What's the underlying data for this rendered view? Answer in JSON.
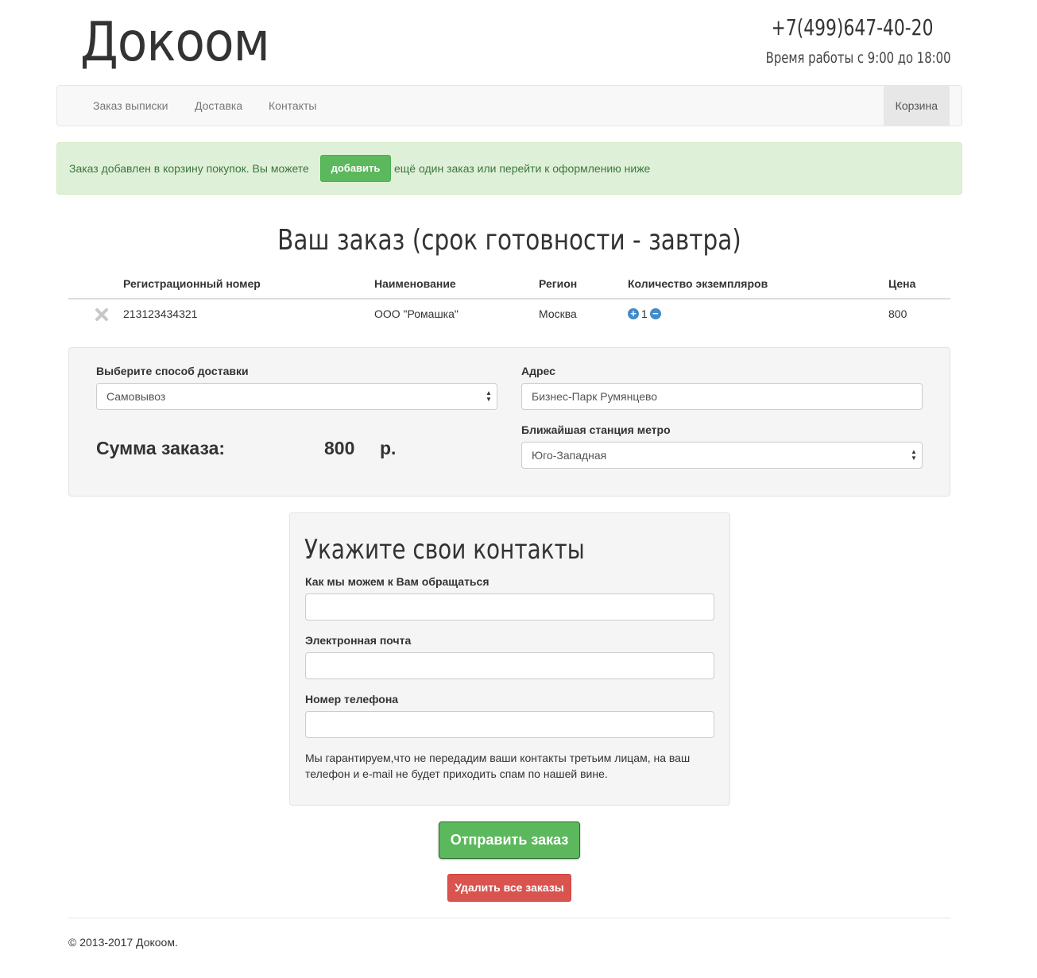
{
  "header": {
    "logo": "Докоом",
    "phone": "+7(499)647-40-20",
    "hours": "Время работы с 9:00 до 18:00"
  },
  "nav": {
    "items": [
      "Заказ выписки",
      "Доставка",
      "Контакты"
    ],
    "cart": "Корзина"
  },
  "alert": {
    "text_before": "Заказ добавлен в корзину покупок. Вы можете",
    "button": "добавить",
    "text_after": "ещё один заказ или перейти к оформлению ниже"
  },
  "order": {
    "title": "Ваш заказ (срок готовности - завтра)",
    "columns": [
      "Регистрационный номер",
      "Наименование",
      "Регион",
      "Количество экземпляров",
      "Цена"
    ],
    "rows": [
      {
        "reg_number": "213123434321",
        "name": "ООО \"Ромашка\"",
        "region": "Москва",
        "quantity": "1",
        "price": "800"
      }
    ]
  },
  "delivery": {
    "method_label": "Выберите способ доставки",
    "method_value": "Самовывоз",
    "address_label": "Адрес",
    "address_value": "Бизнес-Парк Румянцево",
    "metro_label": "Ближайшая станция метро",
    "metro_value": "Юго-Западная",
    "sum_label": "Сумма заказа:",
    "sum_value": "800",
    "currency": "р."
  },
  "contacts": {
    "title": "Укажите свои контакты",
    "name_label": "Как мы можем к Вам обращаться",
    "name_value": "",
    "email_label": "Электронная почта",
    "email_value": "",
    "phone_label": "Номер телефона",
    "phone_value": "",
    "guarantee": "Мы гарантируем,что не передадим ваши контакты третьим лицам, на ваш телефон и e-mail не будет приходить спам по нашей вине."
  },
  "actions": {
    "submit": "Отправить заказ",
    "delete_all": "Удалить все заказы"
  },
  "footer": {
    "copyright": "2013-2017 Докоом."
  },
  "colors": {
    "success": "#5cb85c",
    "danger": "#d9534f",
    "alert_bg": "#dff0d8",
    "alert_text": "#3c763d",
    "well_bg": "#f5f5f5",
    "primary": "#428bca"
  }
}
